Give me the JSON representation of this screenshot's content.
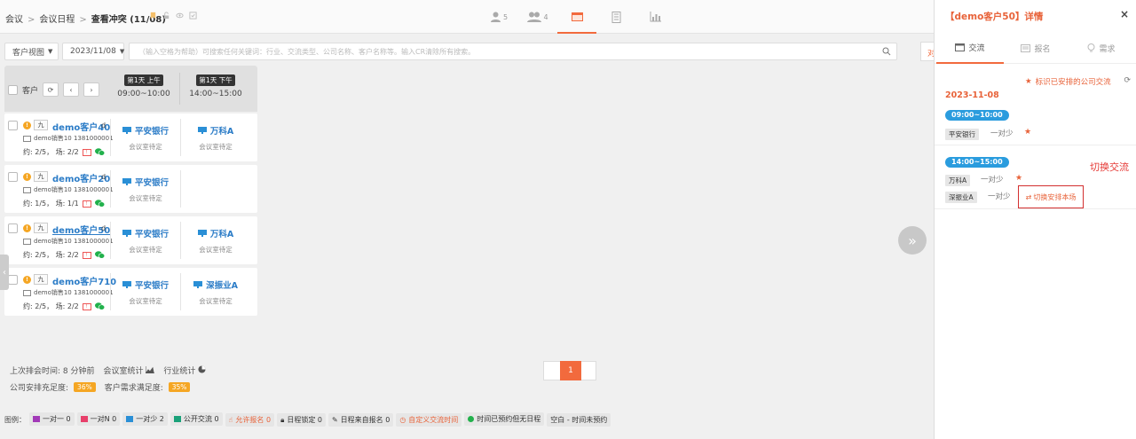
{
  "breadcrumb": [
    "会议",
    "会议日程",
    "查看冲突 (11/08)"
  ],
  "center_tabs": [
    {
      "name": "tab-single-user",
      "count": "5"
    },
    {
      "name": "tab-group-users",
      "count": "4"
    },
    {
      "name": "tab-calendar",
      "count": ""
    },
    {
      "name": "tab-building",
      "count": ""
    },
    {
      "name": "tab-chart",
      "count": ""
    }
  ],
  "filters": {
    "view_label": "客户视图",
    "date_label": "2023/11/08",
    "search_placeholder": "（输入空格为帮助）可搜索任何关键词：行业、交流类型、公司名称、客户名称等。输入CR清除所有搜索。",
    "cut_button_label": "对"
  },
  "table": {
    "header_label": "客户",
    "slots": [
      {
        "day": "第1天 上午",
        "time": "09:00~10:00"
      },
      {
        "day": "第1天 下午",
        "time": "14:00~15:00"
      }
    ],
    "rows": [
      {
        "nine": "九",
        "name": "demo客户40",
        "d": "d",
        "sales": "demo销售10 1381000001",
        "stats": "约: 2/5， 场: 2/2",
        "cells": [
          {
            "company": "平安银行",
            "status": "会议室待定"
          },
          {
            "company": "万科A",
            "status": "会议室待定"
          }
        ]
      },
      {
        "nine": "九",
        "name": "demo客户20",
        "d": "d",
        "sales": "demo销售10 1381000001",
        "stats": "约: 1/5， 场: 1/1",
        "cells": [
          {
            "company": "平安银行",
            "status": "会议室待定"
          }
        ]
      },
      {
        "nine": "九",
        "name": "demo客户50",
        "d": "d",
        "sales": "demo销售10 1381000001",
        "stats": "约: 2/5， 场: 2/2",
        "cells": [
          {
            "company": "平安银行",
            "status": "会议室待定"
          },
          {
            "company": "万科A",
            "status": "会议室待定"
          }
        ]
      },
      {
        "nine": "九",
        "name": "demo客户710",
        "d": "",
        "sales": "demo销售10 1381000001",
        "stats": "约: 2/5， 场: 2/2",
        "cells": [
          {
            "company": "平安银行",
            "status": "会议室待定"
          },
          {
            "company": "深振业A",
            "status": "会议室待定"
          }
        ]
      }
    ]
  },
  "footer": {
    "last_schedule": "上次排会时间: 8 分钟前",
    "room_stats": "会议室统计",
    "industry_stats": "行业统计",
    "company_fill_label": "公司安排充足度:",
    "company_fill_value": "36%",
    "customer_satisfy_label": "客户需求满足度:",
    "customer_satisfy_value": "35%",
    "page": "1"
  },
  "legend": {
    "title": "图例：",
    "items": [
      {
        "label": "一对一 0",
        "color": "#a23ab8",
        "kind": "sq"
      },
      {
        "label": "一对N 0",
        "color": "#e8406b",
        "kind": "sq"
      },
      {
        "label": "一对少 2",
        "color": "#2a8fd6",
        "kind": "sq"
      },
      {
        "label": "公开交流 0",
        "color": "#1aa179",
        "kind": "sq"
      },
      {
        "label": "允许报名 0",
        "color": "#e8633a",
        "kind": "hand"
      },
      {
        "label": "日程锁定 0",
        "color": "#333333",
        "kind": "lock"
      },
      {
        "label": "日程来自报名 0",
        "color": "#333333",
        "kind": "pen"
      },
      {
        "label": "自定义交流时间",
        "color": "#e8633a",
        "kind": "clock"
      },
      {
        "label": "时间已预约但无日程",
        "color": "#22b14c",
        "kind": "dot"
      },
      {
        "label": "空白 - 时间未预约",
        "color": "#333333",
        "kind": "none"
      }
    ]
  },
  "panel": {
    "title": "【demo客户50】详情",
    "tabs": [
      "交流",
      "报名",
      "需求"
    ],
    "mark_label": "标识已安排的公司交流",
    "date": "2023-11-08",
    "slot1": {
      "time": "09:00~10:00",
      "company": "平安银行",
      "mode": "一对少"
    },
    "slot2": {
      "time": "14:00~15:00",
      "company": "万科A",
      "mode": "一对少",
      "company2": "深振业A",
      "mode2": "一对少"
    },
    "switch_label": "切换安排本场",
    "switch_note": "切换交流"
  },
  "colors": {
    "accent": "#f26a3d",
    "link": "#2b7cc7",
    "pill": "#2a9cde",
    "badge": "#f5a623"
  }
}
